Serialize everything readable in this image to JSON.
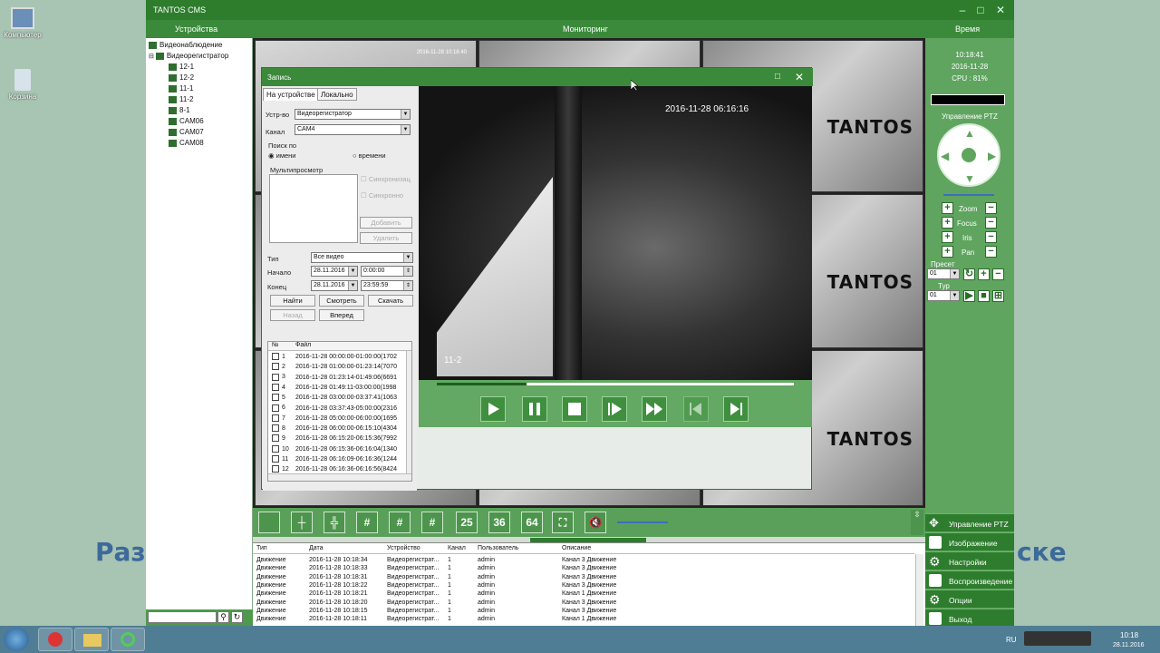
{
  "desktop": {
    "icons": [
      {
        "label": "Компьютер"
      },
      {
        "label": "Корзина"
      }
    ],
    "bg_text_left": "Раз",
    "bg_text_right": "ске"
  },
  "app": {
    "title": "TANTOS CMS",
    "top": {
      "devices": "Устройства",
      "monitoring": "Мониторинг",
      "time": "Время"
    }
  },
  "tree": {
    "root": "Видеонаблюдение",
    "dvr": "Видеорегистратор",
    "channels": [
      "12-1",
      "12-2",
      "11-1",
      "11-2",
      "8-1",
      "CAM06",
      "CAM07",
      "CAM08"
    ]
  },
  "grid": {
    "cell_timestamp": "2016-11-28 10:18:40",
    "logo": "TANTOS"
  },
  "dialog": {
    "title": "Запись",
    "tabs": [
      "На устройстве",
      "Локально"
    ],
    "device_label": "Устр-во",
    "device_value": "Видеорегистратор",
    "channel_label": "Канал",
    "channel_value": "CAM4",
    "search_label": "Поиск по",
    "radio_name": "имени",
    "radio_time": "времени",
    "multi_label": "Мультипросмотр",
    "cb_sync": "Синхронизац",
    "cb_single": "Синхронно",
    "add_btn": "Добавить",
    "del_btn": "Удалить",
    "type_label": "Тип",
    "type_value": "Все видео",
    "start_label": "Начало",
    "start_date": "28.11.2016",
    "start_time": "0:00:00",
    "end_label": "Конец",
    "end_date": "28.11.2016",
    "end_time": "23:59:59",
    "find_btn": "Найти",
    "view_btn": "Смотреть",
    "download_btn": "Скачать",
    "back_btn": "Назад",
    "fwd_btn": "Вперед",
    "col_no": "№",
    "col_file": "Файл",
    "files": [
      {
        "n": "1",
        "f": "2016-11-28 00:00:00-01:00:00(1702"
      },
      {
        "n": "2",
        "f": "2016-11-28 01:00:00-01:23:14(7070"
      },
      {
        "n": "3",
        "f": "2016-11-28 01:23:14-01:49:06(6691"
      },
      {
        "n": "4",
        "f": "2016-11-28 01:49:11-03:00:00(1998"
      },
      {
        "n": "5",
        "f": "2016-11-28 03:00:00-03:37:41(1063"
      },
      {
        "n": "6",
        "f": "2016-11-28 03:37:43-05:00:00(2316"
      },
      {
        "n": "7",
        "f": "2016-11-28 05:00:00-06:00:00(1695"
      },
      {
        "n": "8",
        "f": "2016-11-28 06:00:00-06:15:10(4304"
      },
      {
        "n": "9",
        "f": "2016-11-28 06:15:20-06:15:36(7992"
      },
      {
        "n": "10",
        "f": "2016-11-28 06:15:36-06:16:04(1340"
      },
      {
        "n": "11",
        "f": "2016-11-28 06:16:09-06:16:36(1244"
      },
      {
        "n": "12",
        "f": "2016-11-28 06:16:36-06:16:56(8424"
      }
    ],
    "video_ts": "2016-11-28 06:16:16",
    "video_ch": "11-2",
    "progress": 0.25
  },
  "right": {
    "time": "10:18:41",
    "date": "2016-11-28",
    "cpu": "CPU : 81%",
    "ptz_title": "Управление PTZ",
    "zoom": "Zoom",
    "focus": "Focus",
    "iris": "Iris",
    "pan": "Pan",
    "preset": "Пресет",
    "preset_val": "01",
    "tour": "Тур",
    "tour_val": "01",
    "menu": [
      "Управление PTZ",
      "Изображение",
      "Настройки",
      "Воспроизведение",
      "Опции",
      "Выход"
    ]
  },
  "layouts": [
    "25",
    "36",
    "64"
  ],
  "events": {
    "cols": [
      "Тип",
      "Дата",
      "Устройство",
      "Канал",
      "Пользователь",
      "Описание"
    ],
    "rows": [
      [
        "Движение",
        "2016-11-28 10:18:34",
        "Видеорегистрат...",
        "1",
        "admin",
        "Канал 3 Движение"
      ],
      [
        "Движение",
        "2016-11-28 10:18:33",
        "Видеорегистрат...",
        "1",
        "admin",
        "Канал 3 Движение"
      ],
      [
        "Движение",
        "2016-11-28 10:18:31",
        "Видеорегистрат...",
        "1",
        "admin",
        "Канал 3 Движение"
      ],
      [
        "Движение",
        "2016-11-28 10:18:22",
        "Видеорегистрат...",
        "1",
        "admin",
        "Канал 3 Движение"
      ],
      [
        "Движение",
        "2016-11-28 10:18:21",
        "Видеорегистрат...",
        "1",
        "admin",
        "Канал 1 Движение"
      ],
      [
        "Движение",
        "2016-11-28 10:18:20",
        "Видеорегистрат...",
        "1",
        "admin",
        "Канал 3 Движение"
      ],
      [
        "Движение",
        "2016-11-28 10:18:15",
        "Видеорегистрат...",
        "1",
        "admin",
        "Канал 3 Движение"
      ],
      [
        "Движение",
        "2016-11-28 10:18:11",
        "Видеорегистрат...",
        "1",
        "admin",
        "Канал 1 Движение"
      ]
    ]
  },
  "taskbar": {
    "lang": "RU",
    "time": "10:18",
    "date": "28.11.2016"
  }
}
